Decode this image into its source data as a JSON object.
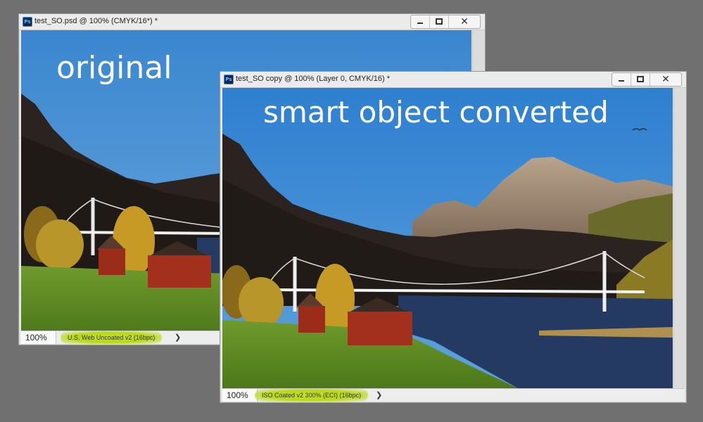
{
  "windows": [
    {
      "title": "test_SO.psd @ 100% (CMYK/16*) *",
      "overlay_label": "original",
      "zoom": "100%",
      "color_profile": "U.S. Web Uncoated v2 (16bpc)",
      "arrow": "❯"
    },
    {
      "title": "test_SO copy @ 100% (Layer 0, CMYK/16) *",
      "overlay_label": "smart object converted",
      "zoom": "100%",
      "color_profile": "ISO Coated v2 300% (ECI) (16bpc)",
      "arrow": "❯"
    }
  ],
  "colors": {
    "desktop": "#707070",
    "sky": "#3f8fd6",
    "profile_highlight": "#b7d914"
  },
  "icons": [
    "photoshop-icon",
    "minimize-icon",
    "maximize-icon",
    "close-icon"
  ]
}
